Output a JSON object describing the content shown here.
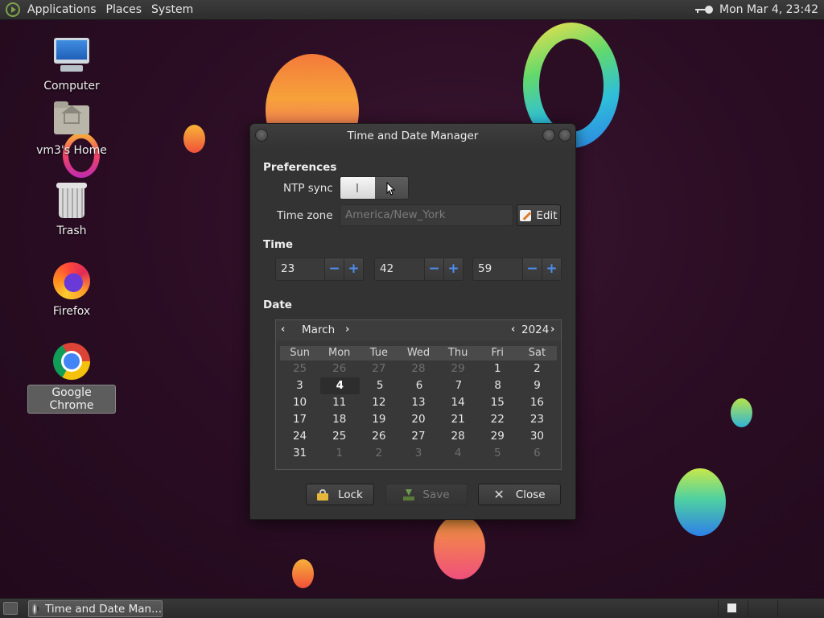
{
  "top_panel": {
    "menus": [
      "Applications",
      "Places",
      "System"
    ],
    "clock": "Mon Mar  4, 23:42"
  },
  "desktop_icons": [
    {
      "label": "Computer",
      "icon": "computer-icon"
    },
    {
      "label": "vm3's Home",
      "icon": "home-folder-icon"
    },
    {
      "label": "Trash",
      "icon": "trash-icon"
    },
    {
      "label": "Firefox",
      "icon": "firefox-icon"
    },
    {
      "label": "Google Chrome",
      "icon": "chrome-icon",
      "selected": true
    }
  ],
  "dialog": {
    "title": "Time and Date Manager",
    "preferences_heading": "Preferences",
    "ntp_label": "NTP sync",
    "ntp_enabled": true,
    "timezone_label": "Time zone",
    "timezone_value": "America/New_York",
    "edit_label": "Edit",
    "time_heading": "Time",
    "hour": "23",
    "minute": "42",
    "second": "59",
    "minus_glyph": "−",
    "plus_glyph": "+",
    "date_heading": "Date",
    "calendar": {
      "month": "March",
      "year": "2024",
      "prev_glyph": "‹",
      "next_glyph": "›",
      "weekdays": [
        "Sun",
        "Mon",
        "Tue",
        "Wed",
        "Thu",
        "Fri",
        "Sat"
      ],
      "weeks": [
        [
          "25",
          "26",
          "27",
          "28",
          "29",
          "1",
          "2"
        ],
        [
          "3",
          "4",
          "5",
          "6",
          "7",
          "8",
          "9"
        ],
        [
          "10",
          "11",
          "12",
          "13",
          "14",
          "15",
          "16"
        ],
        [
          "17",
          "18",
          "19",
          "20",
          "21",
          "22",
          "23"
        ],
        [
          "24",
          "25",
          "26",
          "27",
          "28",
          "29",
          "30"
        ],
        [
          "31",
          "1",
          "2",
          "3",
          "4",
          "5",
          "6"
        ]
      ],
      "selected_day": "4"
    },
    "lock_label": "Lock",
    "save_label": "Save",
    "close_label": "Close",
    "close_glyph": "✕"
  },
  "taskbar": {
    "task_label": "Time and Date Man..."
  }
}
